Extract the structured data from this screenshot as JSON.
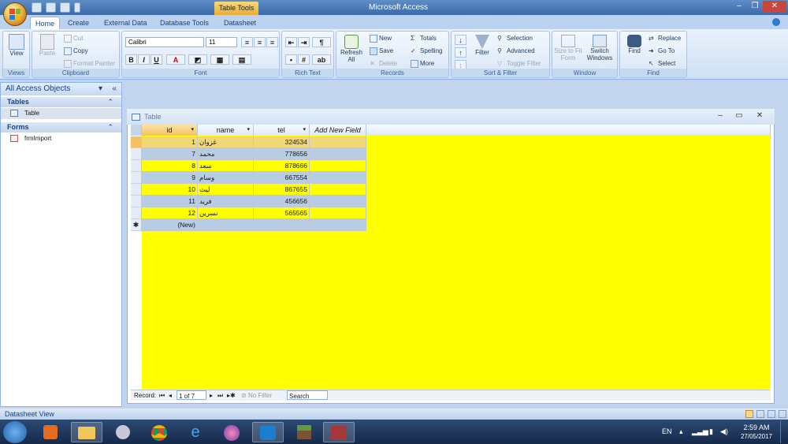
{
  "window": {
    "title": "Microsoft Access",
    "context_tab": "Table Tools"
  },
  "tabs": [
    "Home",
    "Create",
    "External Data",
    "Database Tools",
    "Datasheet"
  ],
  "ribbon": {
    "views": {
      "view": "View",
      "label": "Views"
    },
    "clipboard": {
      "paste": "Paste",
      "cut": "Cut",
      "copy": "Copy",
      "format_painter": "Format Painter",
      "label": "Clipboard"
    },
    "font": {
      "name": "Calibri",
      "size": "11",
      "bold": "B",
      "italic": "I",
      "underline": "U",
      "label": "Font"
    },
    "rich_text": {
      "label": "Rich Text"
    },
    "records": {
      "refresh": "Refresh All",
      "new": "New",
      "save": "Save",
      "delete": "Delete",
      "totals": "Totals",
      "spelling": "Spelling",
      "more": "More",
      "label": "Records"
    },
    "sort_filter": {
      "filter": "Filter",
      "selection": "Selection",
      "advanced": "Advanced",
      "toggle": "Toggle Filter",
      "label": "Sort & Filter"
    },
    "window": {
      "size": "Size to Fit Form",
      "switch": "Switch Windows",
      "label": "Window"
    },
    "find": {
      "find": "Find",
      "replace": "Replace",
      "goto": "Go To",
      "select": "Select",
      "label": "Find"
    }
  },
  "nav": {
    "header": "All Access Objects",
    "sections": [
      {
        "title": "Tables",
        "items": [
          "Table"
        ]
      },
      {
        "title": "Forms",
        "items": [
          "frmImport"
        ]
      }
    ]
  },
  "datasheet": {
    "title": "Table",
    "columns": [
      "id",
      "name",
      "tel",
      "Add New Field"
    ],
    "rows": [
      {
        "id": "1",
        "name": "غزوان",
        "tel": "324534"
      },
      {
        "id": "7",
        "name": "محمد",
        "tel": "778656"
      },
      {
        "id": "8",
        "name": "سعد",
        "tel": "878666"
      },
      {
        "id": "9",
        "name": "وسام",
        "tel": "667554"
      },
      {
        "id": "10",
        "name": "ليث",
        "tel": "867655"
      },
      {
        "id": "11",
        "name": "فريد",
        "tel": "456656"
      },
      {
        "id": "12",
        "name": "نسرين",
        "tel": "565565"
      }
    ],
    "new_row": "(New)",
    "new_marker": "✱",
    "recbar": {
      "label": "Record:",
      "position": "1 of 7",
      "no_filter": "No Filter",
      "search": "Search"
    }
  },
  "status": "Datasheet View",
  "taskbar": {
    "lang": "EN",
    "time": "2:59 AM",
    "date": "27/05/2017"
  },
  "colors": {
    "row_yellow": "#ffff00",
    "row_blue": "#b8cce4",
    "row_current": "#f2d875"
  }
}
